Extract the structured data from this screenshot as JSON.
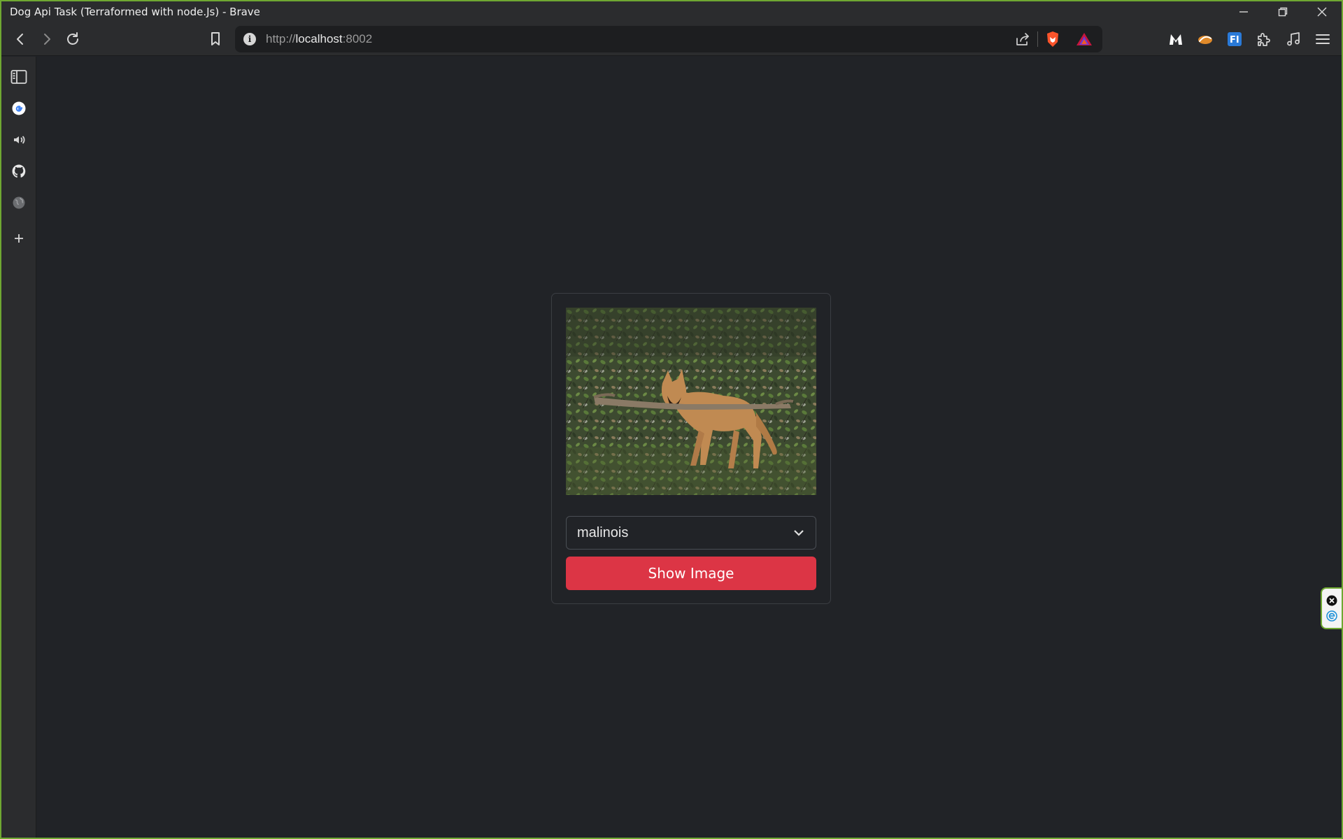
{
  "window": {
    "title": "Dog Api Task (Terraformed with node.Js) - Brave"
  },
  "toolbar": {
    "url_scheme": "http://",
    "url_host": "localhost",
    "url_port": ":8002"
  },
  "extensions": [
    "malwarebytes-icon",
    "stylus-icon",
    "fi-icon",
    "puzzle-icon",
    "music-icon",
    "menu-icon"
  ],
  "sidebar": {
    "items": [
      "sidebar-panel-icon",
      "google-icon",
      "speaker-icon",
      "github-icon",
      "globe-icon",
      "plus-icon"
    ]
  },
  "card": {
    "image_alt": "malinois",
    "select": {
      "value": "malinois"
    },
    "button_label": "Show Image"
  },
  "colors": {
    "background": "#212327",
    "accent_button": "#dc3545",
    "window_border": "#6fa832"
  }
}
